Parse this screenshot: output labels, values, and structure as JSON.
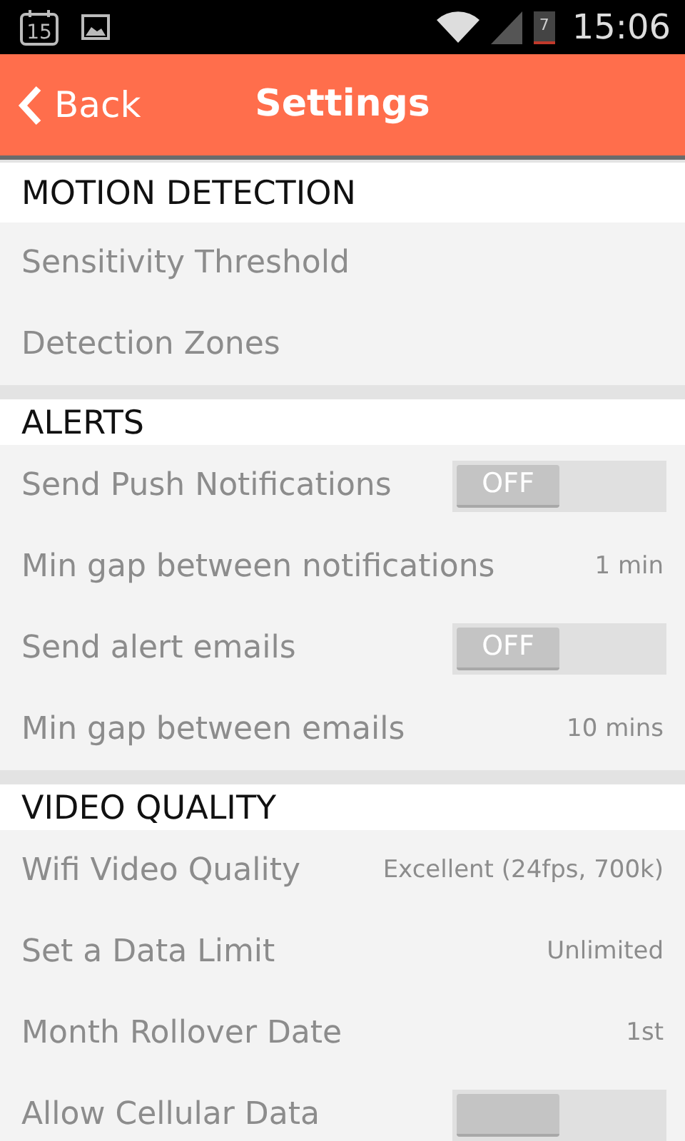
{
  "status_bar": {
    "calendar_day": "15",
    "battery_level_text": "7",
    "time": "15:06"
  },
  "header": {
    "back": "Back",
    "title": "Settings"
  },
  "sections": [
    {
      "title": "MOTION DETECTION",
      "rows": [
        {
          "kind": "link",
          "label": "Sensitivity Threshold"
        },
        {
          "kind": "link",
          "label": "Detection Zones"
        }
      ]
    },
    {
      "title": "ALERTS",
      "rows": [
        {
          "kind": "toggle",
          "label": "Send Push Notifications",
          "on": false,
          "toggle_text": "OFF"
        },
        {
          "kind": "value",
          "label": "Min gap between notifications",
          "value": "1 min"
        },
        {
          "kind": "toggle",
          "label": "Send alert emails",
          "on": false,
          "toggle_text": "OFF"
        },
        {
          "kind": "value",
          "label": "Min gap between emails",
          "value": "10 mins"
        }
      ]
    },
    {
      "title": "VIDEO QUALITY",
      "rows": [
        {
          "kind": "value",
          "label": "Wifi Video Quality",
          "value": "Excellent (24fps, 700k)"
        },
        {
          "kind": "value",
          "label": "Set a Data Limit",
          "value": "Unlimited"
        },
        {
          "kind": "value",
          "label": "Month Rollover Date",
          "value": "1st"
        },
        {
          "kind": "toggle",
          "label": "Allow Cellular Data",
          "on": false
        }
      ]
    }
  ]
}
